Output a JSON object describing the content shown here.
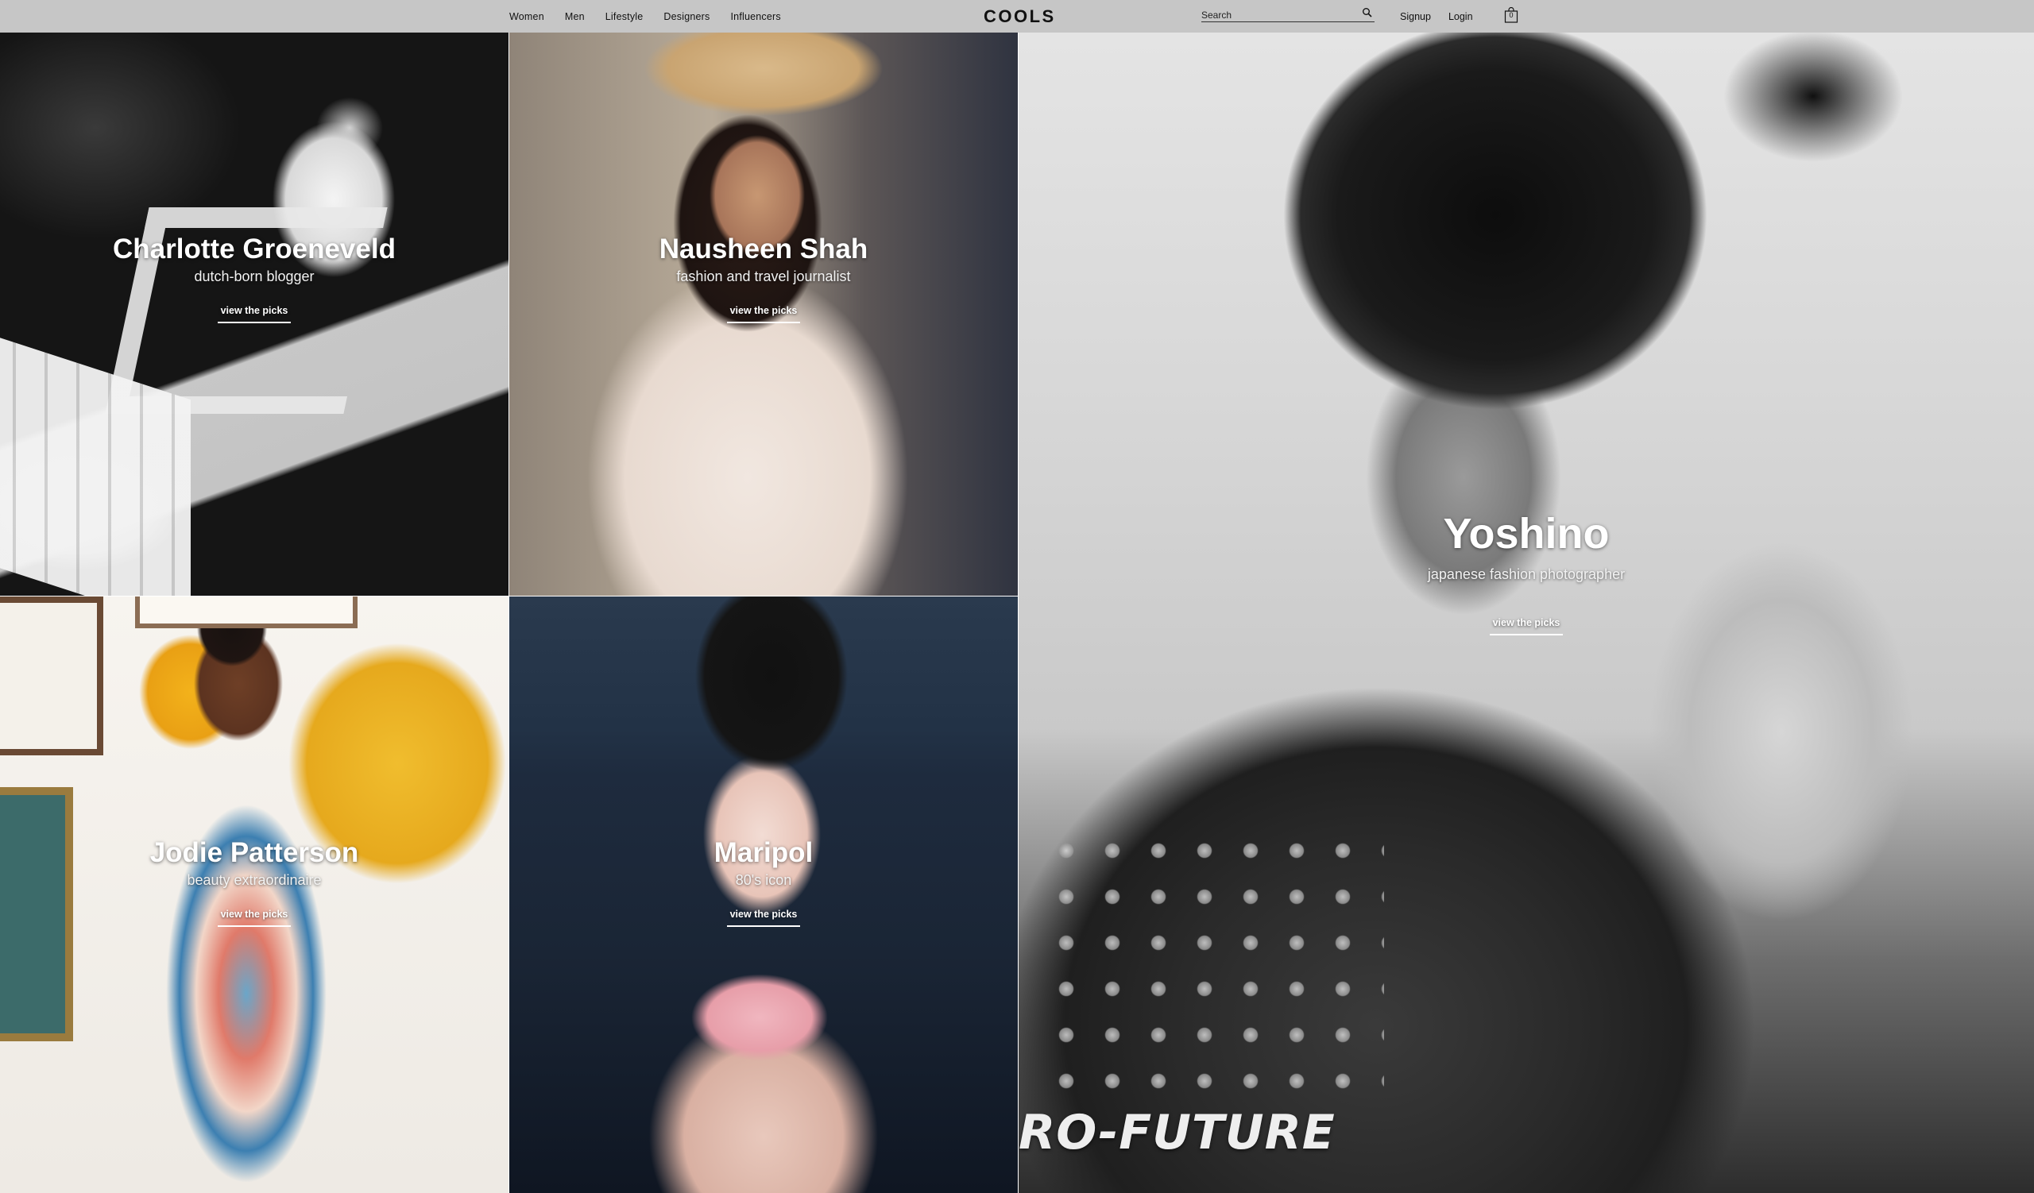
{
  "header": {
    "nav": [
      "Women",
      "Men",
      "Lifestyle",
      "Designers",
      "Influencers"
    ],
    "logo": "COOLS",
    "search": {
      "placeholder": "Search",
      "icon": "search-icon"
    },
    "signup": "Signup",
    "login": "Login",
    "cart": {
      "icon": "shopping-bag-icon",
      "count": "0"
    }
  },
  "influencers": [
    {
      "name": "Charlotte Groeneveld",
      "description": "dutch-born blogger",
      "cta": "view the picks"
    },
    {
      "name": "Nausheen Shah",
      "description": "fashion and travel journalist",
      "cta": "view the picks"
    },
    {
      "name": "Jodie Patterson",
      "description": "beauty extraordinaire",
      "cta": "view the picks"
    },
    {
      "name": "Maripol",
      "description": "80's icon",
      "cta": "view the picks"
    },
    {
      "name": "Yoshino",
      "description": "japanese fashion photographer",
      "cta": "view the picks",
      "jacket_text": "RO-FUTURE"
    }
  ]
}
